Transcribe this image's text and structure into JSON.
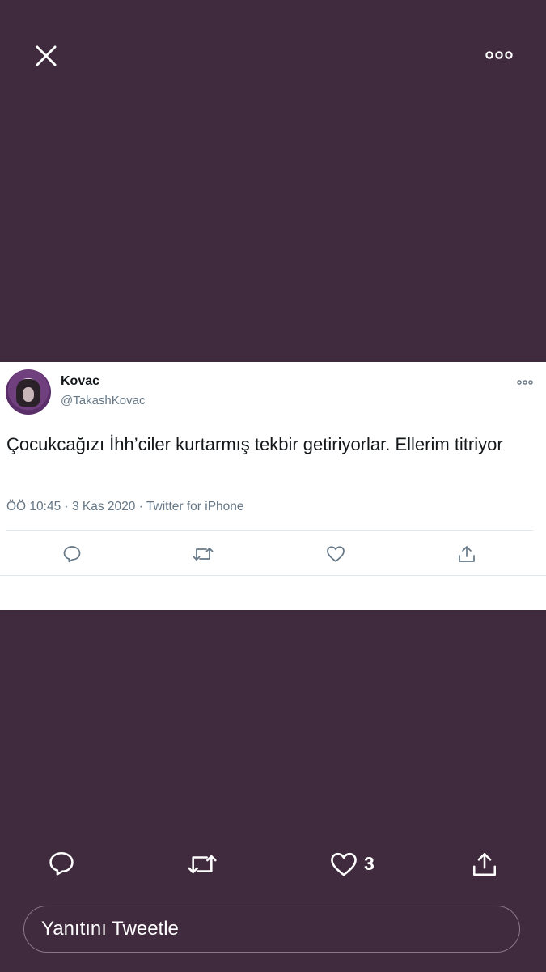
{
  "top_bar": {
    "close_icon": "close-icon",
    "more_icon": "more-horizontal-icon"
  },
  "tweet_card": {
    "user": {
      "name": "Kovac",
      "handle": "@TakashKovac"
    },
    "text": "Çocukcağızı İhh’ciler kurtarmış tekbir getiriyorlar. Ellerim titriyor",
    "meta": "ÖÖ 10:45 · 3 Kas 2020 · Twitter for iPhone",
    "actions": [
      "reply-icon",
      "retweet-icon",
      "like-icon",
      "share-icon"
    ]
  },
  "action_bar": {
    "like_count": "3",
    "icons": [
      "reply-icon",
      "retweet-icon",
      "heart-icon",
      "share-icon"
    ]
  },
  "reply": {
    "placeholder": "Yanıtını Tweetle"
  },
  "colors": {
    "background": "#402a3d",
    "card": "#ffffff",
    "secondary_text": "#657786"
  }
}
